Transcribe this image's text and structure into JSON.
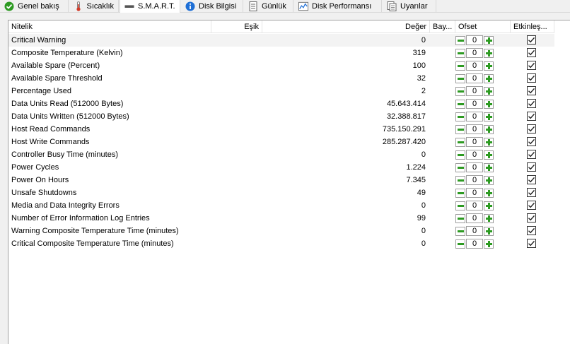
{
  "tabs": [
    {
      "label": "Genel bakış",
      "icon": "check-circle-icon"
    },
    {
      "label": "Sıcaklık",
      "icon": "thermometer-icon"
    },
    {
      "label": "S.M.A.R.T.",
      "icon": "drive-icon"
    },
    {
      "label": "Disk Bilgisi",
      "icon": "info-icon"
    },
    {
      "label": "Günlük",
      "icon": "log-document-icon"
    },
    {
      "label": "Disk Performansı",
      "icon": "performance-chart-icon"
    },
    {
      "label": "Uyarılar",
      "icon": "alerts-document-icon"
    }
  ],
  "active_tab": "S.M.A.R.T.",
  "columns": {
    "attribute": "Nitelik",
    "threshold": "Eşik",
    "value": "Değer",
    "flag": "Bay...",
    "offset": "Ofset",
    "enabled": "Etkinleş..."
  },
  "rows": [
    {
      "name": "Critical Warning",
      "value": "0",
      "offset": "0",
      "enabled": true
    },
    {
      "name": "Composite Temperature (Kelvin)",
      "value": "319",
      "offset": "0",
      "enabled": true
    },
    {
      "name": "Available Spare (Percent)",
      "value": "100",
      "offset": "0",
      "enabled": true
    },
    {
      "name": "Available Spare Threshold",
      "value": "32",
      "offset": "0",
      "enabled": true
    },
    {
      "name": "Percentage Used",
      "value": "2",
      "offset": "0",
      "enabled": true
    },
    {
      "name": "Data Units Read (512000 Bytes)",
      "value": "45.643.414",
      "offset": "0",
      "enabled": true
    },
    {
      "name": "Data Units Written (512000 Bytes)",
      "value": "32.388.817",
      "offset": "0",
      "enabled": true
    },
    {
      "name": "Host Read Commands",
      "value": "735.150.291",
      "offset": "0",
      "enabled": true
    },
    {
      "name": "Host Write Commands",
      "value": "285.287.420",
      "offset": "0",
      "enabled": true
    },
    {
      "name": "Controller Busy Time (minutes)",
      "value": "0",
      "offset": "0",
      "enabled": true
    },
    {
      "name": "Power Cycles",
      "value": "1.224",
      "offset": "0",
      "enabled": true
    },
    {
      "name": "Power On Hours",
      "value": "7.345",
      "offset": "0",
      "enabled": true
    },
    {
      "name": "Unsafe Shutdowns",
      "value": "49",
      "offset": "0",
      "enabled": true
    },
    {
      "name": "Media and Data Integrity Errors",
      "value": "0",
      "offset": "0",
      "enabled": true
    },
    {
      "name": "Number of Error Information Log Entries",
      "value": "99",
      "offset": "0",
      "enabled": true
    },
    {
      "name": "Warning Composite Temperature Time (minutes)",
      "value": "0",
      "offset": "0",
      "enabled": true
    },
    {
      "name": "Critical Composite Temperature Time (minutes)",
      "value": "0",
      "offset": "0",
      "enabled": true
    }
  ],
  "colors": {
    "accent_green": "#2d9a22",
    "info_blue": "#1e6fd6",
    "thermometer_red": "#d33c2a"
  }
}
